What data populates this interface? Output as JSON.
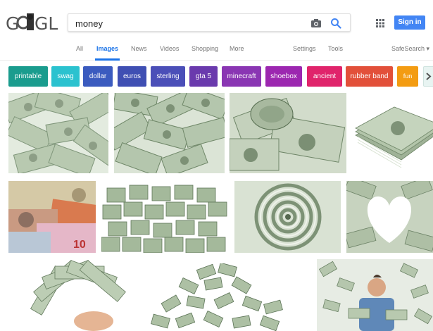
{
  "search": {
    "query": "money"
  },
  "header": {
    "logo_text": "GOOGLE",
    "signin_label": "Sign in"
  },
  "tabs": [
    {
      "label": "All"
    },
    {
      "label": "Images"
    },
    {
      "label": "News"
    },
    {
      "label": "Videos"
    },
    {
      "label": "Shopping"
    },
    {
      "label": "More"
    },
    {
      "label": "Settings"
    },
    {
      "label": "Tools"
    }
  ],
  "safesearch": "SafeSearch ▾",
  "chips": [
    {
      "label": "printable",
      "color": "#1a9c8e"
    },
    {
      "label": "swag",
      "color": "#2bc2cf"
    },
    {
      "label": "dollar",
      "color": "#3b5bbf"
    },
    {
      "label": "euros",
      "color": "#3f4fb3"
    },
    {
      "label": "sterling",
      "color": "#4b4fb8"
    },
    {
      "label": "gta 5",
      "color": "#6a3aad"
    },
    {
      "label": "minecraft",
      "color": "#8a36b3"
    },
    {
      "label": "shoebox",
      "color": "#9c27b0"
    },
    {
      "label": "ancient",
      "color": "#e0246b"
    },
    {
      "label": "rubber band",
      "color": "#e2503a"
    },
    {
      "label": "fun",
      "color": "#f39c12"
    }
  ],
  "icons": {
    "camera": "camera-icon",
    "search": "search-icon",
    "apps": "apps-grid-icon",
    "chevron": "chevron-right-icon"
  },
  "colors": {
    "accent": "#1a73e8",
    "signin": "#4285f4"
  }
}
